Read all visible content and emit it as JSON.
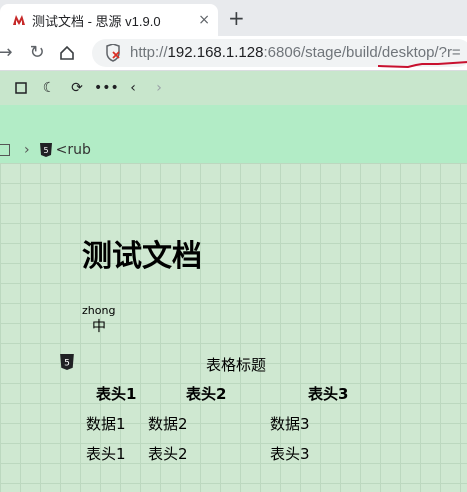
{
  "browser": {
    "tab_title": "测试文档 - 思源 v1.9.0",
    "tab_close": "×",
    "new_tab": "+",
    "url": {
      "protocol": "http://",
      "host": "192.168.1.128",
      "rest": ":6806/stage/build/desktop/?r="
    }
  },
  "breadcrumb": {
    "item": "<rub"
  },
  "document": {
    "title": "测试文档",
    "ruby_annotation": "zhong",
    "ruby_base": "中",
    "table": {
      "caption": "表格标题",
      "headers": [
        "表头1",
        "表头2",
        "表头3"
      ],
      "rows": [
        [
          "数据1",
          "数据2",
          "数据3"
        ],
        [
          "表头1",
          "表头2",
          "表头3"
        ]
      ]
    }
  },
  "colors": {
    "banner": "#b2ecc6",
    "canvas": "#cfe8d1",
    "accent_red": "#c8102e"
  }
}
